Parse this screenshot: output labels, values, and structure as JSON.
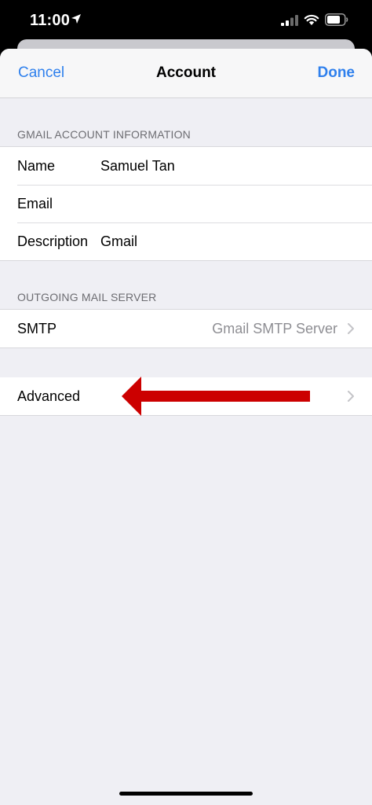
{
  "status_bar": {
    "time": "11:00",
    "icons": [
      "location-arrow-icon",
      "signal-icon",
      "wifi-icon",
      "battery-icon"
    ]
  },
  "nav": {
    "cancel": "Cancel",
    "title": "Account",
    "done": "Done"
  },
  "account_section": {
    "header": "GMAIL ACCOUNT INFORMATION",
    "rows": [
      {
        "label": "Name",
        "value": "Samuel Tan"
      },
      {
        "label": "Email",
        "value": ""
      },
      {
        "label": "Description",
        "value": "Gmail"
      }
    ]
  },
  "outgoing_section": {
    "header": "OUTGOING MAIL SERVER",
    "smtp_label": "SMTP",
    "smtp_value": "Gmail SMTP Server"
  },
  "advanced_section": {
    "label": "Advanced"
  },
  "colors": {
    "accent": "#2f80ed",
    "annotation_arrow": "#cc0000",
    "background": "#efeff4"
  }
}
